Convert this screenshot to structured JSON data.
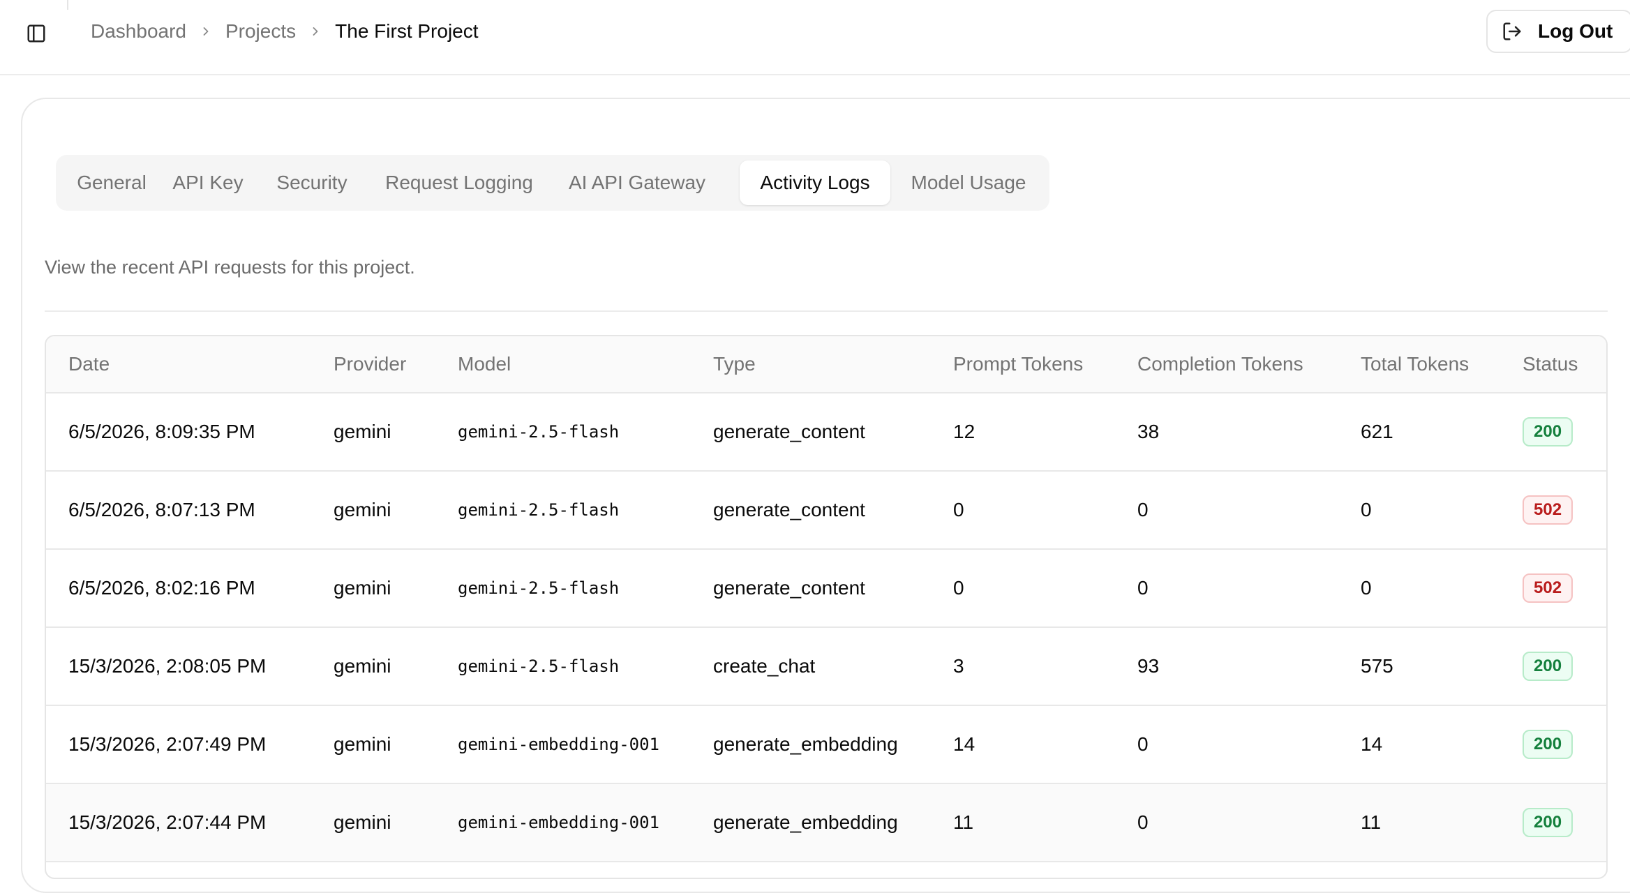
{
  "breadcrumb": {
    "items": [
      "Dashboard",
      "Projects"
    ],
    "current": "The First Project"
  },
  "header": {
    "logout_label": "Log Out"
  },
  "tabs": [
    {
      "label": "General",
      "active": false
    },
    {
      "label": "API Key",
      "active": false
    },
    {
      "label": "Security",
      "active": false
    },
    {
      "label": "Request Logging",
      "active": false
    },
    {
      "label": "AI API Gateway",
      "active": false
    },
    {
      "label": "Activity Logs",
      "active": true
    },
    {
      "label": "Model Usage",
      "active": false
    }
  ],
  "description": "View the recent API requests for this project.",
  "table": {
    "columns": [
      "Date",
      "Provider",
      "Model",
      "Type",
      "Prompt Tokens",
      "Completion Tokens",
      "Total Tokens",
      "Status"
    ],
    "rows": [
      {
        "date": "6/5/2026, 8:09:35 PM",
        "provider": "gemini",
        "model": "gemini-2.5-flash",
        "type": "generate_content",
        "prompt": "12",
        "completion": "38",
        "total": "621",
        "status": "200"
      },
      {
        "date": "6/5/2026, 8:07:13 PM",
        "provider": "gemini",
        "model": "gemini-2.5-flash",
        "type": "generate_content",
        "prompt": "0",
        "completion": "0",
        "total": "0",
        "status": "502"
      },
      {
        "date": "6/5/2026, 8:02:16 PM",
        "provider": "gemini",
        "model": "gemini-2.5-flash",
        "type": "generate_content",
        "prompt": "0",
        "completion": "0",
        "total": "0",
        "status": "502"
      },
      {
        "date": "15/3/2026, 2:08:05 PM",
        "provider": "gemini",
        "model": "gemini-2.5-flash",
        "type": "create_chat",
        "prompt": "3",
        "completion": "93",
        "total": "575",
        "status": "200"
      },
      {
        "date": "15/3/2026, 2:07:49 PM",
        "provider": "gemini",
        "model": "gemini-embedding-001",
        "type": "generate_embedding",
        "prompt": "14",
        "completion": "0",
        "total": "14",
        "status": "200"
      },
      {
        "date": "15/3/2026, 2:07:44 PM",
        "provider": "gemini",
        "model": "gemini-embedding-001",
        "type": "generate_embedding",
        "prompt": "11",
        "completion": "0",
        "total": "11",
        "status": "200"
      }
    ]
  },
  "colors": {
    "status_ok": "#15803d",
    "status_error": "#b91c1c",
    "muted_text": "#737373"
  },
  "icons": {
    "sidebar_toggle": "panel-left-icon",
    "breadcrumb_separator": "chevron-right-icon",
    "logout": "log-out-icon"
  }
}
